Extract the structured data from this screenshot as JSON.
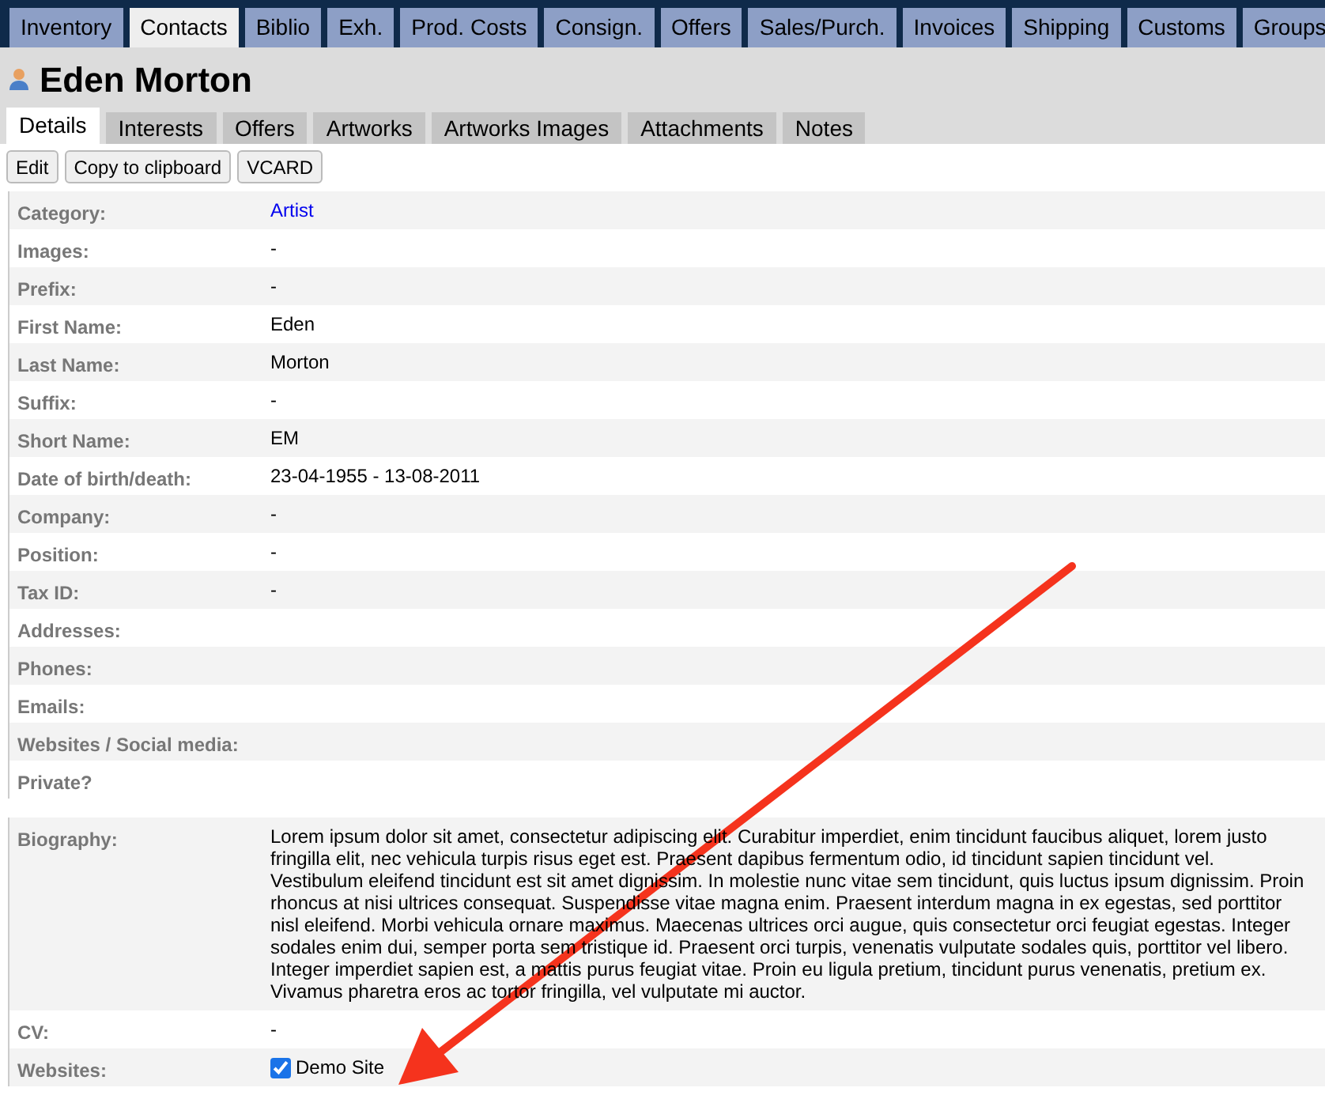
{
  "main_tabs": [
    {
      "label": "Inventory",
      "selected": false
    },
    {
      "label": "Contacts",
      "selected": true
    },
    {
      "label": "Biblio",
      "selected": false
    },
    {
      "label": "Exh.",
      "selected": false
    },
    {
      "label": "Prod. Costs",
      "selected": false
    },
    {
      "label": "Consign.",
      "selected": false
    },
    {
      "label": "Offers",
      "selected": false
    },
    {
      "label": "Sales/Purch.",
      "selected": false
    },
    {
      "label": "Invoices",
      "selected": false
    },
    {
      "label": "Shipping",
      "selected": false
    },
    {
      "label": "Customs",
      "selected": false
    },
    {
      "label": "Groups",
      "selected": false
    }
  ],
  "title": "Eden Morton",
  "sub_tabs": [
    {
      "label": "Details",
      "selected": true
    },
    {
      "label": "Interests",
      "selected": false
    },
    {
      "label": "Offers",
      "selected": false
    },
    {
      "label": "Artworks",
      "selected": false
    },
    {
      "label": "Artworks Images",
      "selected": false
    },
    {
      "label": "Attachments",
      "selected": false
    },
    {
      "label": "Notes",
      "selected": false
    }
  ],
  "buttons": [
    "Edit",
    "Copy to clipboard",
    "VCARD"
  ],
  "fields": [
    {
      "label": "Category:",
      "value": "Artist",
      "kind": "link"
    },
    {
      "label": "Images:",
      "value": "-",
      "kind": "text"
    },
    {
      "label": "Prefix:",
      "value": "-",
      "kind": "text"
    },
    {
      "label": "First Name:",
      "value": "Eden",
      "kind": "text"
    },
    {
      "label": "Last Name:",
      "value": "Morton",
      "kind": "text"
    },
    {
      "label": "Suffix:",
      "value": "-",
      "kind": "text"
    },
    {
      "label": "Short Name:",
      "value": "EM",
      "kind": "text"
    },
    {
      "label": "Date of birth/death:",
      "value": "23-04-1955 - 13-08-2011",
      "kind": "text"
    },
    {
      "label": "Company:",
      "value": "-",
      "kind": "text"
    },
    {
      "label": "Position:",
      "value": "-",
      "kind": "text"
    },
    {
      "label": "Tax ID:",
      "value": "-",
      "kind": "text"
    },
    {
      "label": "Addresses:"
    },
    {
      "label": "Phones:"
    },
    {
      "label": "Emails:"
    },
    {
      "label": "Websites / Social media:"
    },
    {
      "label": "Private?"
    }
  ],
  "extra_fields": [
    {
      "label": "Biography:",
      "value": "Lorem ipsum dolor sit amet, consectetur adipiscing elit. Curabitur imperdiet, enim tincidunt faucibus aliquet, lorem justo fringilla elit, nec vehicula turpis risus eget est. Praesent dapibus fermentum odio, id tincidunt sapien tincidunt vel. Vestibulum eleifend tincidunt est sit amet dignissim. In molestie nunc vitae sem tincidunt, quis luctus ipsum dignissim. Proin rhoncus at nisi ultrices consequat. Suspendisse vitae magna enim. Praesent interdum magna in ex egestas, sed porttitor nisl eleifend. Morbi vehicula ornare maximus. Maecenas ultrices orci augue, quis consectetur orci feugiat egestas. Integer sodales enim dui, semper porta sem tristique id. Praesent orci turpis, venenatis vulputate sodales quis, porttitor vel libero. Integer imperdiet sapien est, a mattis purus feugiat vitae. Proin eu ligula pretium, tincidunt purus venenatis, pretium ex. Vivamus pharetra eros ac tortor fringilla, vel vulputate mi auctor.",
      "kind": "text"
    },
    {
      "label": "CV:",
      "value": "-",
      "kind": "text"
    },
    {
      "label": "Websites:",
      "value": "Demo Site",
      "kind": "checkbox",
      "checked": true
    }
  ]
}
